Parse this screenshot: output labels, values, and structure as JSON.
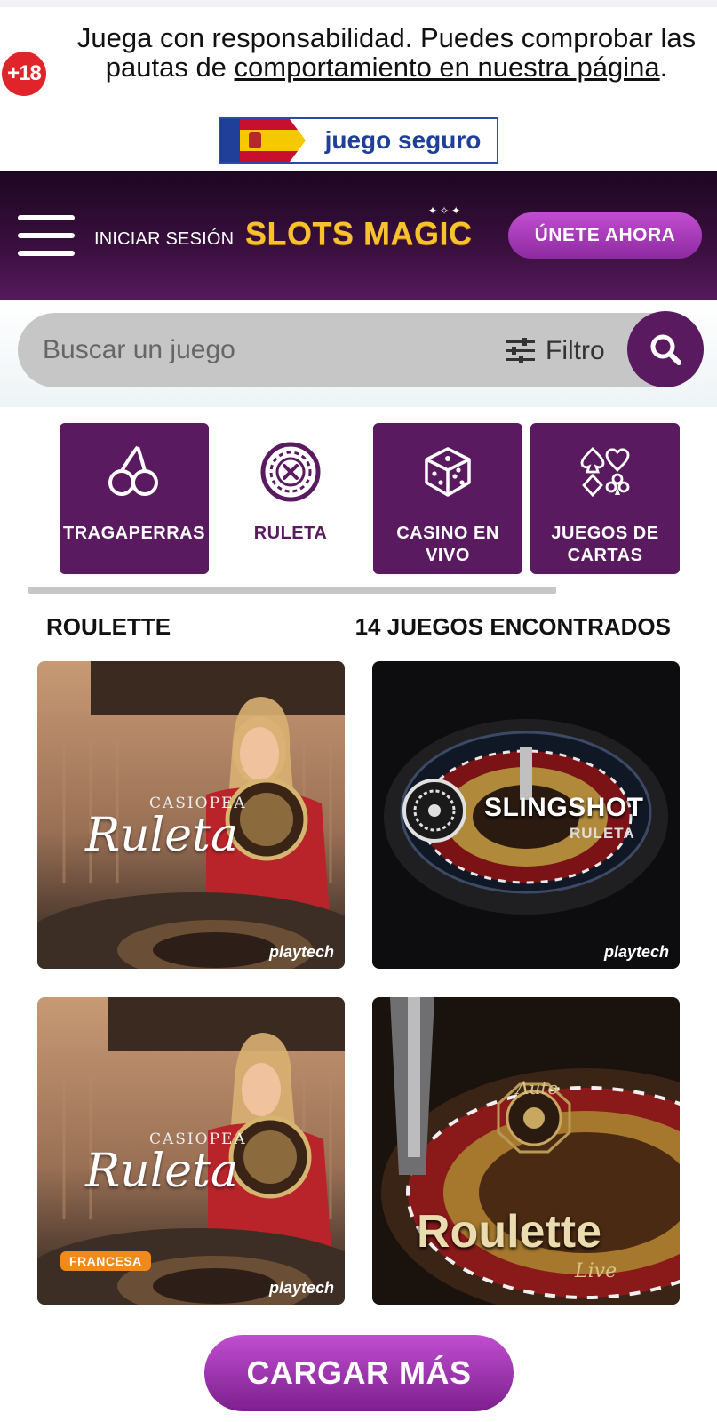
{
  "banner": {
    "age_badge": "+18",
    "text_prefix": "Juega con responsabilidad. Puedes comprobar las pautas de ",
    "text_link": "comportamiento en nuestra página",
    "text_suffix": ".",
    "seal_label": "juego seguro"
  },
  "header": {
    "menu_icon": "hamburger-menu-icon",
    "login_label": "INICIAR SESIÓN",
    "logo_text": "SLOTS MAGIC",
    "join_label": "ÚNETE AHORA"
  },
  "search": {
    "placeholder": "Buscar un juego",
    "filter_label": "Filtro",
    "filter_icon": "sliders-icon",
    "search_icon": "magnifier-icon"
  },
  "categories": [
    {
      "label": "TRAGAPERRAS",
      "icon": "cherries-icon",
      "active": false
    },
    {
      "label": "RULETA",
      "icon": "roulette-wheel-icon",
      "active": true
    },
    {
      "label": "CASINO EN VIVO",
      "icon": "dice-icon",
      "active": false
    },
    {
      "label": "JUEGOS DE CARTAS",
      "icon": "card-suits-icon",
      "active": false
    }
  ],
  "results": {
    "section_title": "ROULETTE",
    "count_label": "14 JUEGOS ENCONTRADOS"
  },
  "games": [
    {
      "brand_line": "CASIOPEA",
      "title": "Ruleta",
      "badge": "",
      "provider": "playtech"
    },
    {
      "brand_line": "SLINGSHOT",
      "title": "RULETA",
      "badge": "",
      "provider": "playtech"
    },
    {
      "brand_line": "CASIOPEA",
      "title": "Ruleta",
      "badge": "FRANCESA",
      "provider": "playtech"
    },
    {
      "brand_line": "Auto",
      "title": "Roulette",
      "badge": "Live",
      "provider": ""
    }
  ],
  "load_more_label": "CARGAR MÁS",
  "colors": {
    "brand_purple": "#5a1a5f",
    "cta_purple": "#a43bb8",
    "logo_gold": "#f7c22b",
    "age_red": "#e0242a"
  }
}
